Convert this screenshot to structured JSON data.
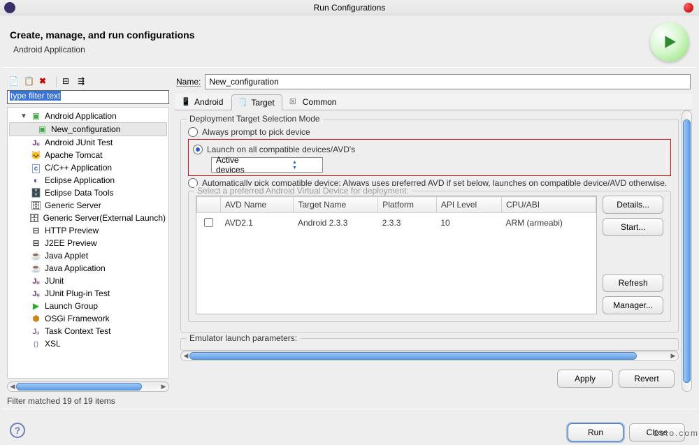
{
  "window": {
    "title": "Run Configurations"
  },
  "header": {
    "title": "Create, manage, and run configurations",
    "subtitle": "Android Application"
  },
  "sidebar": {
    "filter_placeholder": "type filter text",
    "tree": [
      {
        "label": "Android Application",
        "icon": "cfg-android",
        "expanded": true,
        "children": [
          {
            "label": "New_configuration",
            "icon": "cfg-android",
            "selected": true
          }
        ]
      },
      {
        "label": "Android JUnit Test",
        "icon": "cfg-junitA"
      },
      {
        "label": "Apache Tomcat",
        "icon": "cfg-tomcat"
      },
      {
        "label": "C/C++ Application",
        "icon": "cfg-c"
      },
      {
        "label": "Eclipse Application",
        "icon": "cfg-eclipse"
      },
      {
        "label": "Eclipse Data Tools",
        "icon": "cfg-data"
      },
      {
        "label": "Generic Server",
        "icon": "cfg-server"
      },
      {
        "label": "Generic Server(External Launch)",
        "icon": "cfg-server"
      },
      {
        "label": "HTTP Preview",
        "icon": "cfg-http"
      },
      {
        "label": "J2EE Preview",
        "icon": "cfg-j2ee"
      },
      {
        "label": "Java Applet",
        "icon": "cfg-applet"
      },
      {
        "label": "Java Application",
        "icon": "cfg-java"
      },
      {
        "label": "JUnit",
        "icon": "cfg-junit"
      },
      {
        "label": "JUnit Plug-in Test",
        "icon": "cfg-junit"
      },
      {
        "label": "Launch Group",
        "icon": "cfg-launch"
      },
      {
        "label": "OSGi Framework",
        "icon": "cfg-osgi"
      },
      {
        "label": "Task Context Test",
        "icon": "cfg-task"
      },
      {
        "label": "XSL",
        "icon": "cfg-xsl"
      }
    ],
    "filter_status": "Filter matched 19 of 19 items"
  },
  "main": {
    "name_label": "Name:",
    "name_value": "New_configuration",
    "tabs": {
      "android": "Android",
      "target": "Target",
      "common": "Common",
      "active": "target"
    },
    "deployment_mode": {
      "legend": "Deployment Target Selection Mode",
      "opt_prompt": "Always prompt to pick device",
      "opt_launch_all": "Launch on all compatible devices/AVD's",
      "launch_select_value": "Active devices",
      "opt_auto": "Automatically pick compatible device: Always uses preferred AVD if set below, launches on compatible device/AVD otherwise.",
      "avd_legend": "Select a preferred Android Virtual Device for deployment:",
      "columns": {
        "c0": "",
        "c1": "AVD Name",
        "c2": "Target Name",
        "c3": "Platform",
        "c4": "API Level",
        "c5": "CPU/ABI"
      },
      "rows": [
        {
          "checked": false,
          "avd": "AVD2.1",
          "target": "Android 2.3.3",
          "platform": "2.3.3",
          "api": "10",
          "cpu": "ARM (armeabi)"
        }
      ],
      "btn_details": "Details...",
      "btn_start": "Start...",
      "btn_refresh": "Refresh",
      "btn_manager": "Manager..."
    },
    "emulator_legend": "Emulator launch parameters:"
  },
  "buttons": {
    "apply": "Apply",
    "revert": "Revert",
    "run": "Run",
    "close": "Close"
  },
  "watermark": "2cto.com"
}
